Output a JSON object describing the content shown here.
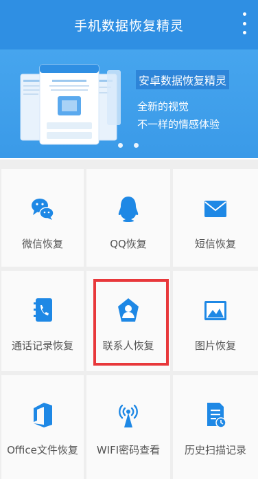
{
  "app_bar": {
    "title": "手机数据恢复精灵",
    "overflow_icon": "more-vertical-icon"
  },
  "banner": {
    "headline": "安卓数据恢复精灵",
    "line1": "全新的视觉",
    "line2": "不一样的情感体验",
    "page_dots": 2
  },
  "grid": {
    "items": [
      {
        "label": "微信恢复",
        "icon": "wechat-icon"
      },
      {
        "label": "QQ恢复",
        "icon": "qq-penguin-icon"
      },
      {
        "label": "短信恢复",
        "icon": "envelope-icon"
      },
      {
        "label": "通话记录恢复",
        "icon": "call-log-icon"
      },
      {
        "label": "联系人恢复",
        "icon": "contact-icon"
      },
      {
        "label": "图片恢复",
        "icon": "picture-icon"
      },
      {
        "label": "Office文件恢复",
        "icon": "office-icon"
      },
      {
        "label": "WIFI密码查看",
        "icon": "wifi-antenna-icon"
      },
      {
        "label": "历史扫描记录",
        "icon": "history-document-icon"
      }
    ]
  },
  "colors": {
    "primary": "#2f8fe3",
    "icon_blue": "#1e88e5",
    "highlight": "#e8383b"
  }
}
